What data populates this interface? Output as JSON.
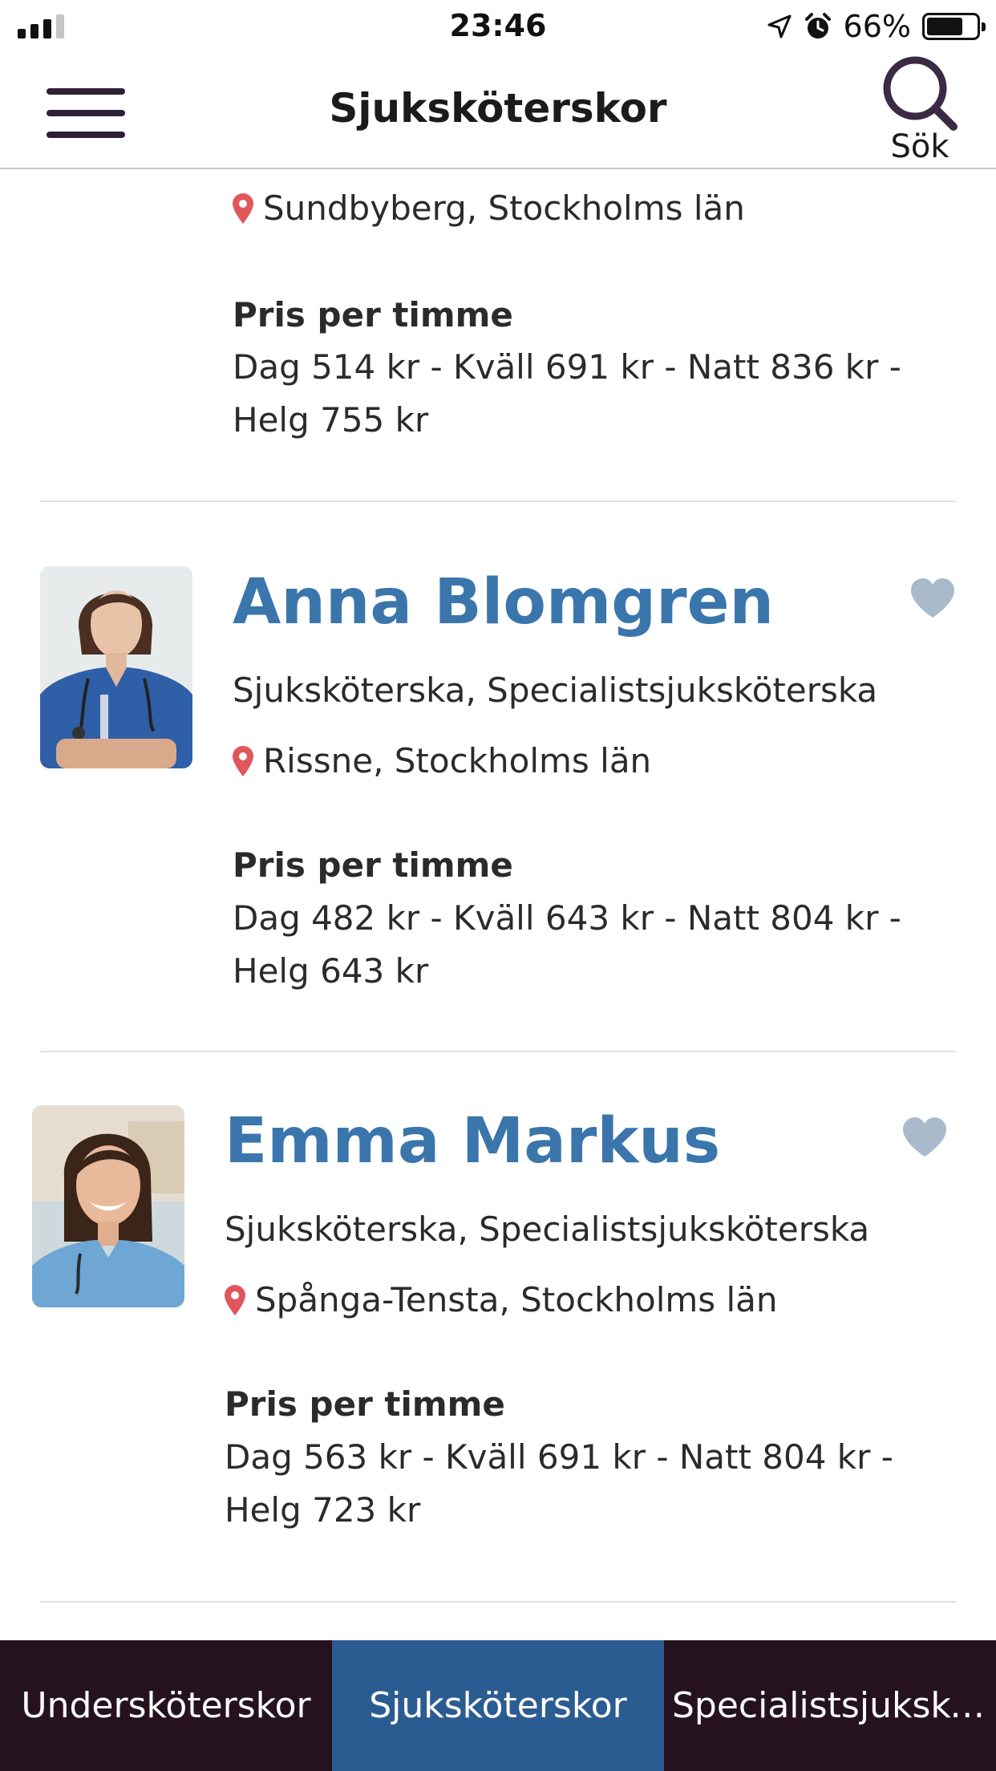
{
  "status_bar": {
    "time": "23:46",
    "battery_percent": "66%",
    "battery_level": 0.66,
    "icons": [
      "signal-icon",
      "location-arrow-icon",
      "alarm-icon",
      "battery-icon"
    ]
  },
  "header": {
    "title": "Sjuksköterskor",
    "search_label": "Sök",
    "icons": [
      "hamburger-menu-icon",
      "search-icon"
    ]
  },
  "colors": {
    "accent_name": "#3a76ac",
    "tab_bar_bg": "#26121f",
    "tab_active_bg": "#2b5c91",
    "pin": "#e0565b",
    "heart": "#a9bbcb"
  },
  "listings": [
    {
      "location": "Sundbyberg, Stockholms län",
      "price_heading": "Pris per timme",
      "price_line1": "Dag 514 kr - Kväll 691 kr - Natt 836 kr -",
      "price_line2": "Helg 755 kr"
    },
    {
      "name": "Anna Blomgren",
      "occupation": "Sjuksköterska, Specialistsjuksköterska",
      "location": "Rissne, Stockholms län",
      "price_heading": "Pris per timme",
      "price_line1": "Dag 482 kr - Kväll 643 kr - Natt 804 kr -",
      "price_line2": "Helg 643 kr"
    },
    {
      "name": "Emma Markus",
      "occupation": "Sjuksköterska, Specialistsjuksköterska",
      "location": "Spånga-Tensta, Stockholms län",
      "price_heading": "Pris per timme",
      "price_line1": "Dag 563 kr - Kväll 691 kr - Natt 804 kr -",
      "price_line2": "Helg 723 kr"
    }
  ],
  "tabs": [
    {
      "label": "Undersköterskor",
      "active": false
    },
    {
      "label": "Sjuksköterskor",
      "active": true
    },
    {
      "label": "Specialistsjukskö...",
      "active": false
    }
  ]
}
